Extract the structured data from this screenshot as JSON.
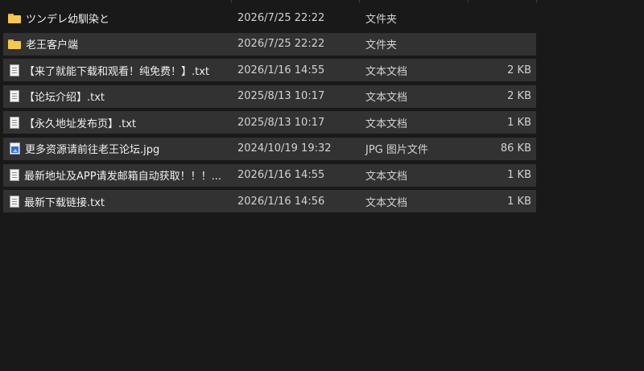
{
  "files": [
    {
      "name": "ツンデレ幼馴染と",
      "date": "2026/7/25 22:22",
      "type": "文件夹",
      "size": "",
      "icon": "folder-icon"
    },
    {
      "name": "老王客户端",
      "date": "2026/7/25 22:22",
      "type": "文件夹",
      "size": "",
      "icon": "folder-icon"
    },
    {
      "name": "【来了就能下载和观看！纯免费！】.txt",
      "date": "2026/1/16 14:55",
      "type": "文本文档",
      "size": "2 KB",
      "icon": "text-document-icon"
    },
    {
      "name": "【论坛介绍】.txt",
      "date": "2025/8/13 10:17",
      "type": "文本文档",
      "size": "2 KB",
      "icon": "text-document-icon"
    },
    {
      "name": "【永久地址发布页】.txt",
      "date": "2025/8/13 10:17",
      "type": "文本文档",
      "size": "1 KB",
      "icon": "text-document-icon"
    },
    {
      "name": "更多资源请前往老王论坛.jpg",
      "date": "2024/10/19 19:32",
      "type": "JPG 图片文件",
      "size": "86 KB",
      "icon": "image-file-icon"
    },
    {
      "name": "最新地址及APP请发邮箱自动获取！！！...",
      "date": "2026/1/16 14:55",
      "type": "文本文档",
      "size": "1 KB",
      "icon": "text-document-icon"
    },
    {
      "name": "最新下载链接.txt",
      "date": "2026/1/16 14:56",
      "type": "文本文档",
      "size": "1 KB",
      "icon": "text-document-icon"
    }
  ],
  "colors": {
    "background": "#191919",
    "selected_row": "#323232",
    "folder": "#f6c94e"
  }
}
